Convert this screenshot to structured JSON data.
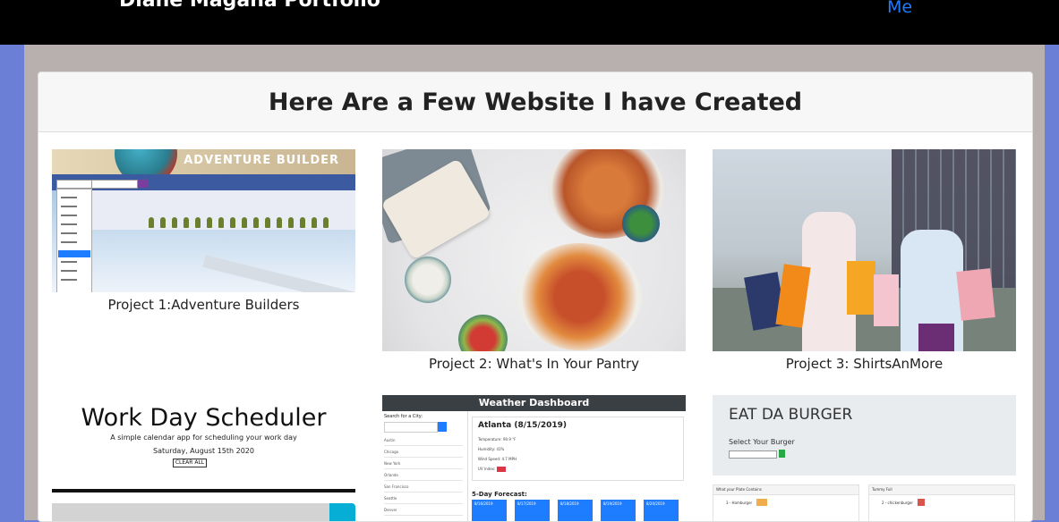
{
  "navbar": {
    "brand": "Diane Magana Portfolio",
    "link_partial": "Me"
  },
  "card": {
    "title": "Here Are a Few Website I have Created"
  },
  "projects": [
    {
      "caption": "Project 1:Adventure Builders",
      "thumb_logo": "ADVENTURE BUILDER"
    },
    {
      "caption": "Project 2: What's In Your Pantry"
    },
    {
      "caption": "Project 3: ShirtsAnMore"
    },
    {
      "caption": "",
      "thumb_title": "Work Day Scheduler",
      "thumb_subtitle": "A simple calendar app for scheduling your work day",
      "thumb_date": "Saturday, August 15th 2020",
      "thumb_button": "CLEAR ALL"
    },
    {
      "caption": "",
      "thumb_header": "Weather Dashboard",
      "thumb_search_label": "Search for a City:",
      "thumb_city": "Atlanta (8/15/2019)",
      "thumb_forecast": "5-Day Forecast:",
      "thumb_dates": [
        "8/16/2019",
        "8/17/2019",
        "8/18/2019",
        "8/19/2019",
        "8/20/2019"
      ],
      "thumb_cities": [
        "Austin",
        "Chicago",
        "New York",
        "Orlando",
        "San Francisco",
        "Seattle",
        "Denver"
      ],
      "thumb_lines": [
        "Temperature: 90.9 °F",
        "Humidity: 41%",
        "Wind Speed: 4.7 MPH",
        "UV Index:"
      ]
    },
    {
      "caption": "",
      "thumb_title": "EAT DA BURGER",
      "thumb_label": "Select Your Burger",
      "thumb_col1": "What your Plate Contains",
      "thumb_col2": "Tummy Full",
      "thumb_item1": "3 - Hamburger",
      "thumb_item2": "2 - chickenburger"
    }
  ],
  "colors": {
    "nav_bg": "#000000",
    "page_bg": "#6b7fd7",
    "content_bg": "#b8b0ae",
    "link": "#1e7cff"
  }
}
